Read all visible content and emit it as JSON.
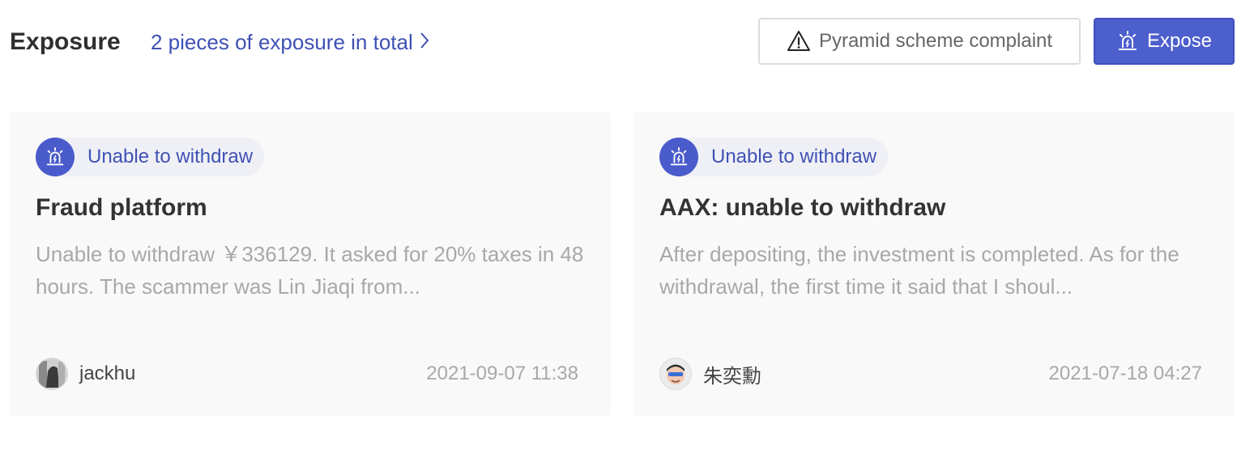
{
  "header": {
    "title": "Exposure",
    "total_link": "2 pieces of exposure in total",
    "complaint_button": "Pyramid scheme complaint",
    "expose_button": "Expose"
  },
  "colors": {
    "accent": "#4d5fcc",
    "link": "#3f51b5",
    "card_bg": "#f9f9f9",
    "muted_text": "#a8a8a8"
  },
  "icons": {
    "complaint": "warning-triangle-icon",
    "expose": "alarm-siren-icon",
    "tag": "alarm-siren-icon",
    "link": "chevron-right-icon"
  },
  "cards": [
    {
      "tag": "Unable to withdraw",
      "title": "Fraud platform",
      "description": "Unable to withdraw ￥336129. It asked for 20% taxes in 48 hours. The scammer was Lin Jiaqi from...",
      "author": "jackhu",
      "date": "2021-09-07 11:38"
    },
    {
      "tag": "Unable to withdraw",
      "title": "AAX: unable to withdraw",
      "description": "After depositing, the investment is completed. As for the withdrawal, the first time it said that I shoul...",
      "author": "朱奕勳",
      "date": "2021-07-18 04:27"
    }
  ]
}
